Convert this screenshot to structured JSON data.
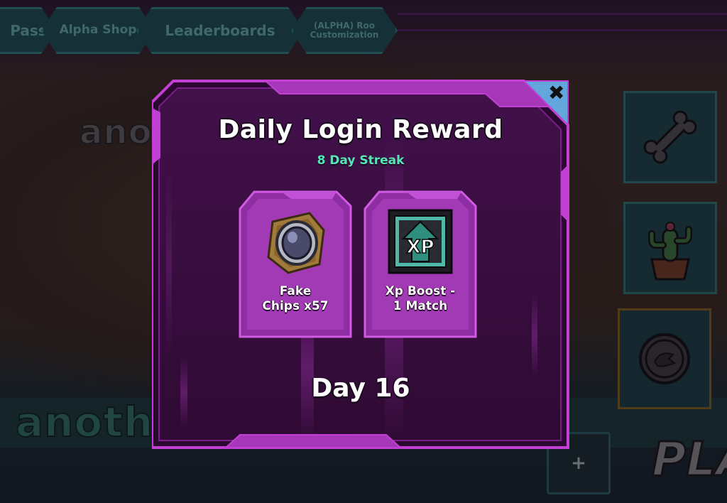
{
  "nav": {
    "tabs": [
      {
        "label": "Pass"
      },
      {
        "label": "Alpha Shop"
      },
      {
        "label": "Leaderboards"
      },
      {
        "label": "(ALPHA) Roo Customization"
      }
    ]
  },
  "background": {
    "player_name_top": "anot",
    "player_name_bottom": "anoth",
    "play_button": "PLA",
    "add_slot_label": "+"
  },
  "modal": {
    "title": "Daily Login Reward",
    "streak": "8 Day Streak",
    "close_label": "✖",
    "rewards": [
      {
        "label": "Fake Chips x57",
        "icon": "chip-icon"
      },
      {
        "label": "Xp Boost - 1 Match",
        "icon": "xp-boost-icon"
      }
    ],
    "xp_badge": "XP",
    "day": "Day 16"
  },
  "colors": {
    "modal_fill": "#3a0a3e",
    "modal_border": "#c13fd2",
    "card_fill": "#a33ab5",
    "streak_text": "#5be3b8",
    "close_corner": "#63a6db"
  }
}
